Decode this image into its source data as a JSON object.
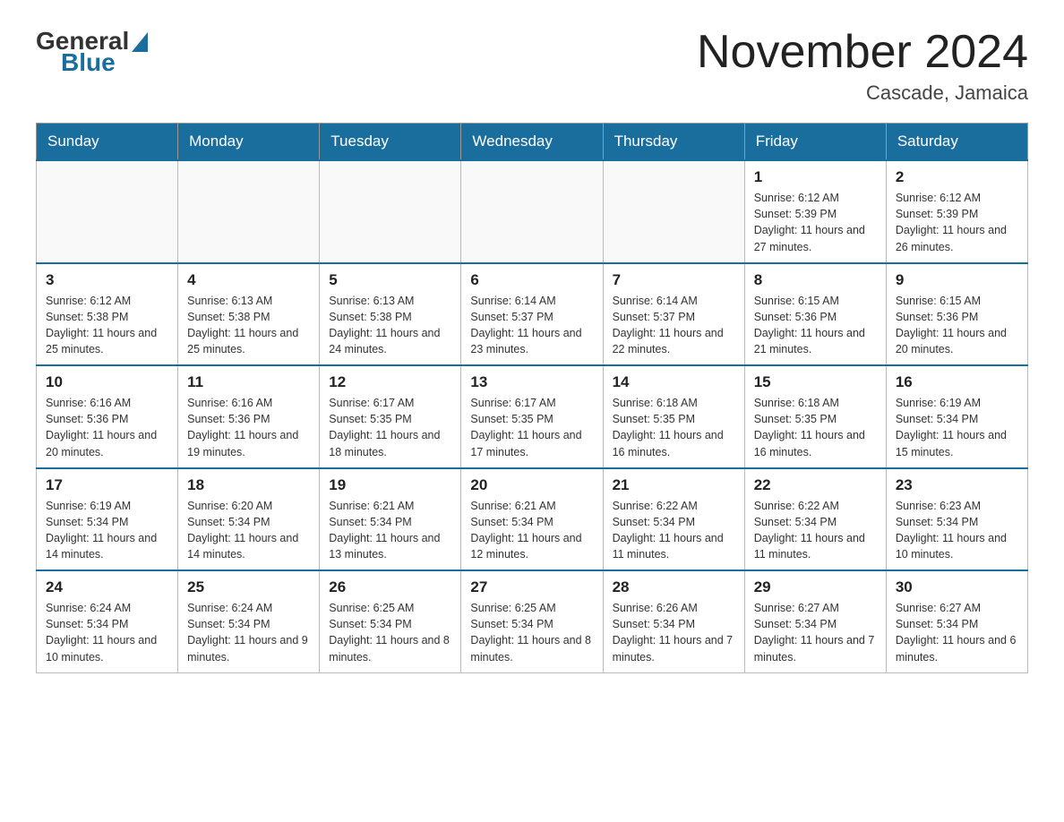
{
  "header": {
    "logo": {
      "general": "General",
      "blue": "Blue"
    },
    "title": "November 2024",
    "location": "Cascade, Jamaica"
  },
  "days_of_week": [
    "Sunday",
    "Monday",
    "Tuesday",
    "Wednesday",
    "Thursday",
    "Friday",
    "Saturday"
  ],
  "weeks": [
    [
      {
        "day": "",
        "info": ""
      },
      {
        "day": "",
        "info": ""
      },
      {
        "day": "",
        "info": ""
      },
      {
        "day": "",
        "info": ""
      },
      {
        "day": "",
        "info": ""
      },
      {
        "day": "1",
        "info": "Sunrise: 6:12 AM\nSunset: 5:39 PM\nDaylight: 11 hours and 27 minutes."
      },
      {
        "day": "2",
        "info": "Sunrise: 6:12 AM\nSunset: 5:39 PM\nDaylight: 11 hours and 26 minutes."
      }
    ],
    [
      {
        "day": "3",
        "info": "Sunrise: 6:12 AM\nSunset: 5:38 PM\nDaylight: 11 hours and 25 minutes."
      },
      {
        "day": "4",
        "info": "Sunrise: 6:13 AM\nSunset: 5:38 PM\nDaylight: 11 hours and 25 minutes."
      },
      {
        "day": "5",
        "info": "Sunrise: 6:13 AM\nSunset: 5:38 PM\nDaylight: 11 hours and 24 minutes."
      },
      {
        "day": "6",
        "info": "Sunrise: 6:14 AM\nSunset: 5:37 PM\nDaylight: 11 hours and 23 minutes."
      },
      {
        "day": "7",
        "info": "Sunrise: 6:14 AM\nSunset: 5:37 PM\nDaylight: 11 hours and 22 minutes."
      },
      {
        "day": "8",
        "info": "Sunrise: 6:15 AM\nSunset: 5:36 PM\nDaylight: 11 hours and 21 minutes."
      },
      {
        "day": "9",
        "info": "Sunrise: 6:15 AM\nSunset: 5:36 PM\nDaylight: 11 hours and 20 minutes."
      }
    ],
    [
      {
        "day": "10",
        "info": "Sunrise: 6:16 AM\nSunset: 5:36 PM\nDaylight: 11 hours and 20 minutes."
      },
      {
        "day": "11",
        "info": "Sunrise: 6:16 AM\nSunset: 5:36 PM\nDaylight: 11 hours and 19 minutes."
      },
      {
        "day": "12",
        "info": "Sunrise: 6:17 AM\nSunset: 5:35 PM\nDaylight: 11 hours and 18 minutes."
      },
      {
        "day": "13",
        "info": "Sunrise: 6:17 AM\nSunset: 5:35 PM\nDaylight: 11 hours and 17 minutes."
      },
      {
        "day": "14",
        "info": "Sunrise: 6:18 AM\nSunset: 5:35 PM\nDaylight: 11 hours and 16 minutes."
      },
      {
        "day": "15",
        "info": "Sunrise: 6:18 AM\nSunset: 5:35 PM\nDaylight: 11 hours and 16 minutes."
      },
      {
        "day": "16",
        "info": "Sunrise: 6:19 AM\nSunset: 5:34 PM\nDaylight: 11 hours and 15 minutes."
      }
    ],
    [
      {
        "day": "17",
        "info": "Sunrise: 6:19 AM\nSunset: 5:34 PM\nDaylight: 11 hours and 14 minutes."
      },
      {
        "day": "18",
        "info": "Sunrise: 6:20 AM\nSunset: 5:34 PM\nDaylight: 11 hours and 14 minutes."
      },
      {
        "day": "19",
        "info": "Sunrise: 6:21 AM\nSunset: 5:34 PM\nDaylight: 11 hours and 13 minutes."
      },
      {
        "day": "20",
        "info": "Sunrise: 6:21 AM\nSunset: 5:34 PM\nDaylight: 11 hours and 12 minutes."
      },
      {
        "day": "21",
        "info": "Sunrise: 6:22 AM\nSunset: 5:34 PM\nDaylight: 11 hours and 11 minutes."
      },
      {
        "day": "22",
        "info": "Sunrise: 6:22 AM\nSunset: 5:34 PM\nDaylight: 11 hours and 11 minutes."
      },
      {
        "day": "23",
        "info": "Sunrise: 6:23 AM\nSunset: 5:34 PM\nDaylight: 11 hours and 10 minutes."
      }
    ],
    [
      {
        "day": "24",
        "info": "Sunrise: 6:24 AM\nSunset: 5:34 PM\nDaylight: 11 hours and 10 minutes."
      },
      {
        "day": "25",
        "info": "Sunrise: 6:24 AM\nSunset: 5:34 PM\nDaylight: 11 hours and 9 minutes."
      },
      {
        "day": "26",
        "info": "Sunrise: 6:25 AM\nSunset: 5:34 PM\nDaylight: 11 hours and 8 minutes."
      },
      {
        "day": "27",
        "info": "Sunrise: 6:25 AM\nSunset: 5:34 PM\nDaylight: 11 hours and 8 minutes."
      },
      {
        "day": "28",
        "info": "Sunrise: 6:26 AM\nSunset: 5:34 PM\nDaylight: 11 hours and 7 minutes."
      },
      {
        "day": "29",
        "info": "Sunrise: 6:27 AM\nSunset: 5:34 PM\nDaylight: 11 hours and 7 minutes."
      },
      {
        "day": "30",
        "info": "Sunrise: 6:27 AM\nSunset: 5:34 PM\nDaylight: 11 hours and 6 minutes."
      }
    ]
  ]
}
